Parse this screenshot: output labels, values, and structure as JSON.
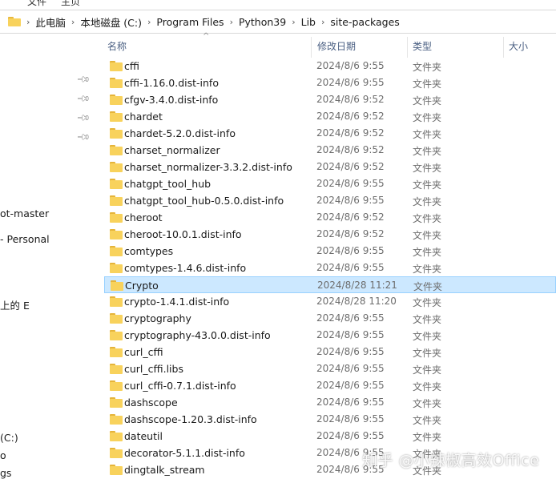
{
  "ribbon": {
    "fragments": [
      "文件",
      "主页"
    ]
  },
  "address_bar": {
    "crumbs": [
      "此电脑",
      "本地磁盘 (C:)",
      "Program Files",
      "Python39",
      "Lib",
      "site-packages"
    ]
  },
  "nav_pane": {
    "fragments": [
      "ot-master",
      "- Personal",
      "上的 E",
      "(C:)",
      "o",
      "gs"
    ]
  },
  "header": {
    "name": "名称",
    "date": "修改日期",
    "type": "类型",
    "size": "大小"
  },
  "files": [
    {
      "name": "cffi",
      "date": "2024/8/6 9:55",
      "type": "文件夹"
    },
    {
      "name": "cffi-1.16.0.dist-info",
      "date": "2024/8/6 9:55",
      "type": "文件夹"
    },
    {
      "name": "cfgv-3.4.0.dist-info",
      "date": "2024/8/6 9:52",
      "type": "文件夹"
    },
    {
      "name": "chardet",
      "date": "2024/8/6 9:52",
      "type": "文件夹"
    },
    {
      "name": "chardet-5.2.0.dist-info",
      "date": "2024/8/6 9:52",
      "type": "文件夹"
    },
    {
      "name": "charset_normalizer",
      "date": "2024/8/6 9:52",
      "type": "文件夹"
    },
    {
      "name": "charset_normalizer-3.3.2.dist-info",
      "date": "2024/8/6 9:52",
      "type": "文件夹"
    },
    {
      "name": "chatgpt_tool_hub",
      "date": "2024/8/6 9:55",
      "type": "文件夹"
    },
    {
      "name": "chatgpt_tool_hub-0.5.0.dist-info",
      "date": "2024/8/6 9:55",
      "type": "文件夹"
    },
    {
      "name": "cheroot",
      "date": "2024/8/6 9:52",
      "type": "文件夹"
    },
    {
      "name": "cheroot-10.0.1.dist-info",
      "date": "2024/8/6 9:52",
      "type": "文件夹"
    },
    {
      "name": "comtypes",
      "date": "2024/8/6 9:55",
      "type": "文件夹"
    },
    {
      "name": "comtypes-1.4.6.dist-info",
      "date": "2024/8/6 9:55",
      "type": "文件夹"
    },
    {
      "name": "Crypto",
      "date": "2024/8/28 11:21",
      "type": "文件夹",
      "selected": true
    },
    {
      "name": "crypto-1.4.1.dist-info",
      "date": "2024/8/28 11:20",
      "type": "文件夹"
    },
    {
      "name": "cryptography",
      "date": "2024/8/6 9:55",
      "type": "文件夹"
    },
    {
      "name": "cryptography-43.0.0.dist-info",
      "date": "2024/8/6 9:55",
      "type": "文件夹"
    },
    {
      "name": "curl_cffi",
      "date": "2024/8/6 9:55",
      "type": "文件夹"
    },
    {
      "name": "curl_cffi.libs",
      "date": "2024/8/6 9:55",
      "type": "文件夹"
    },
    {
      "name": "curl_cffi-0.7.1.dist-info",
      "date": "2024/8/6 9:55",
      "type": "文件夹"
    },
    {
      "name": "dashscope",
      "date": "2024/8/6 9:55",
      "type": "文件夹"
    },
    {
      "name": "dashscope-1.20.3.dist-info",
      "date": "2024/8/6 9:55",
      "type": "文件夹"
    },
    {
      "name": "dateutil",
      "date": "2024/8/6 9:55",
      "type": "文件夹"
    },
    {
      "name": "decorator-5.1.1.dist-info",
      "date": "2024/8/6 9:55",
      "type": "文件夹"
    },
    {
      "name": "dingtalk_stream",
      "date": "2024/8/6 9:55",
      "type": "文件夹"
    }
  ],
  "watermark": "知乎 @小辣椒高效Office"
}
